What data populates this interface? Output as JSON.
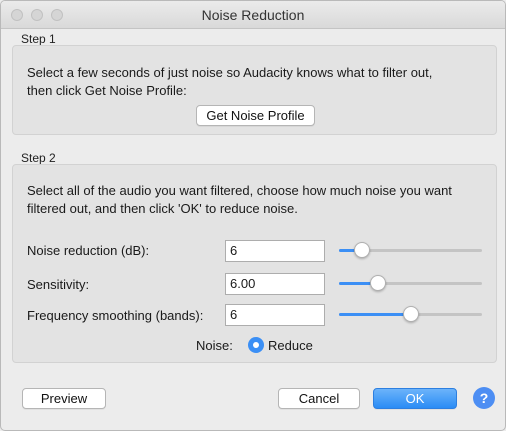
{
  "window": {
    "title": "Noise Reduction"
  },
  "step1": {
    "label": "Step 1",
    "text_line1": "Select a few seconds of just noise so Audacity knows what to filter out,",
    "text_line2": "then click Get Noise Profile:",
    "button": "Get Noise Profile"
  },
  "step2": {
    "label": "Step 2",
    "text_line1": "Select all of the audio you want filtered, choose how much noise you want",
    "text_line2": "filtered out, and then click 'OK' to reduce noise.",
    "rows": [
      {
        "label": "Noise reduction (dB):",
        "value": "6",
        "slider_fraction": 0.16
      },
      {
        "label": "Sensitivity:",
        "value": "6.00",
        "slider_fraction": 0.27
      },
      {
        "label": "Frequency smoothing (bands):",
        "value": "6",
        "slider_fraction": 0.5
      }
    ],
    "noise": {
      "label": "Noise:",
      "option": "Reduce",
      "selected": true
    }
  },
  "footer": {
    "preview": "Preview",
    "cancel": "Cancel",
    "ok": "OK",
    "help": "?"
  },
  "colors": {
    "accent": "#3b8ff5",
    "help": "#4d8ef3"
  }
}
